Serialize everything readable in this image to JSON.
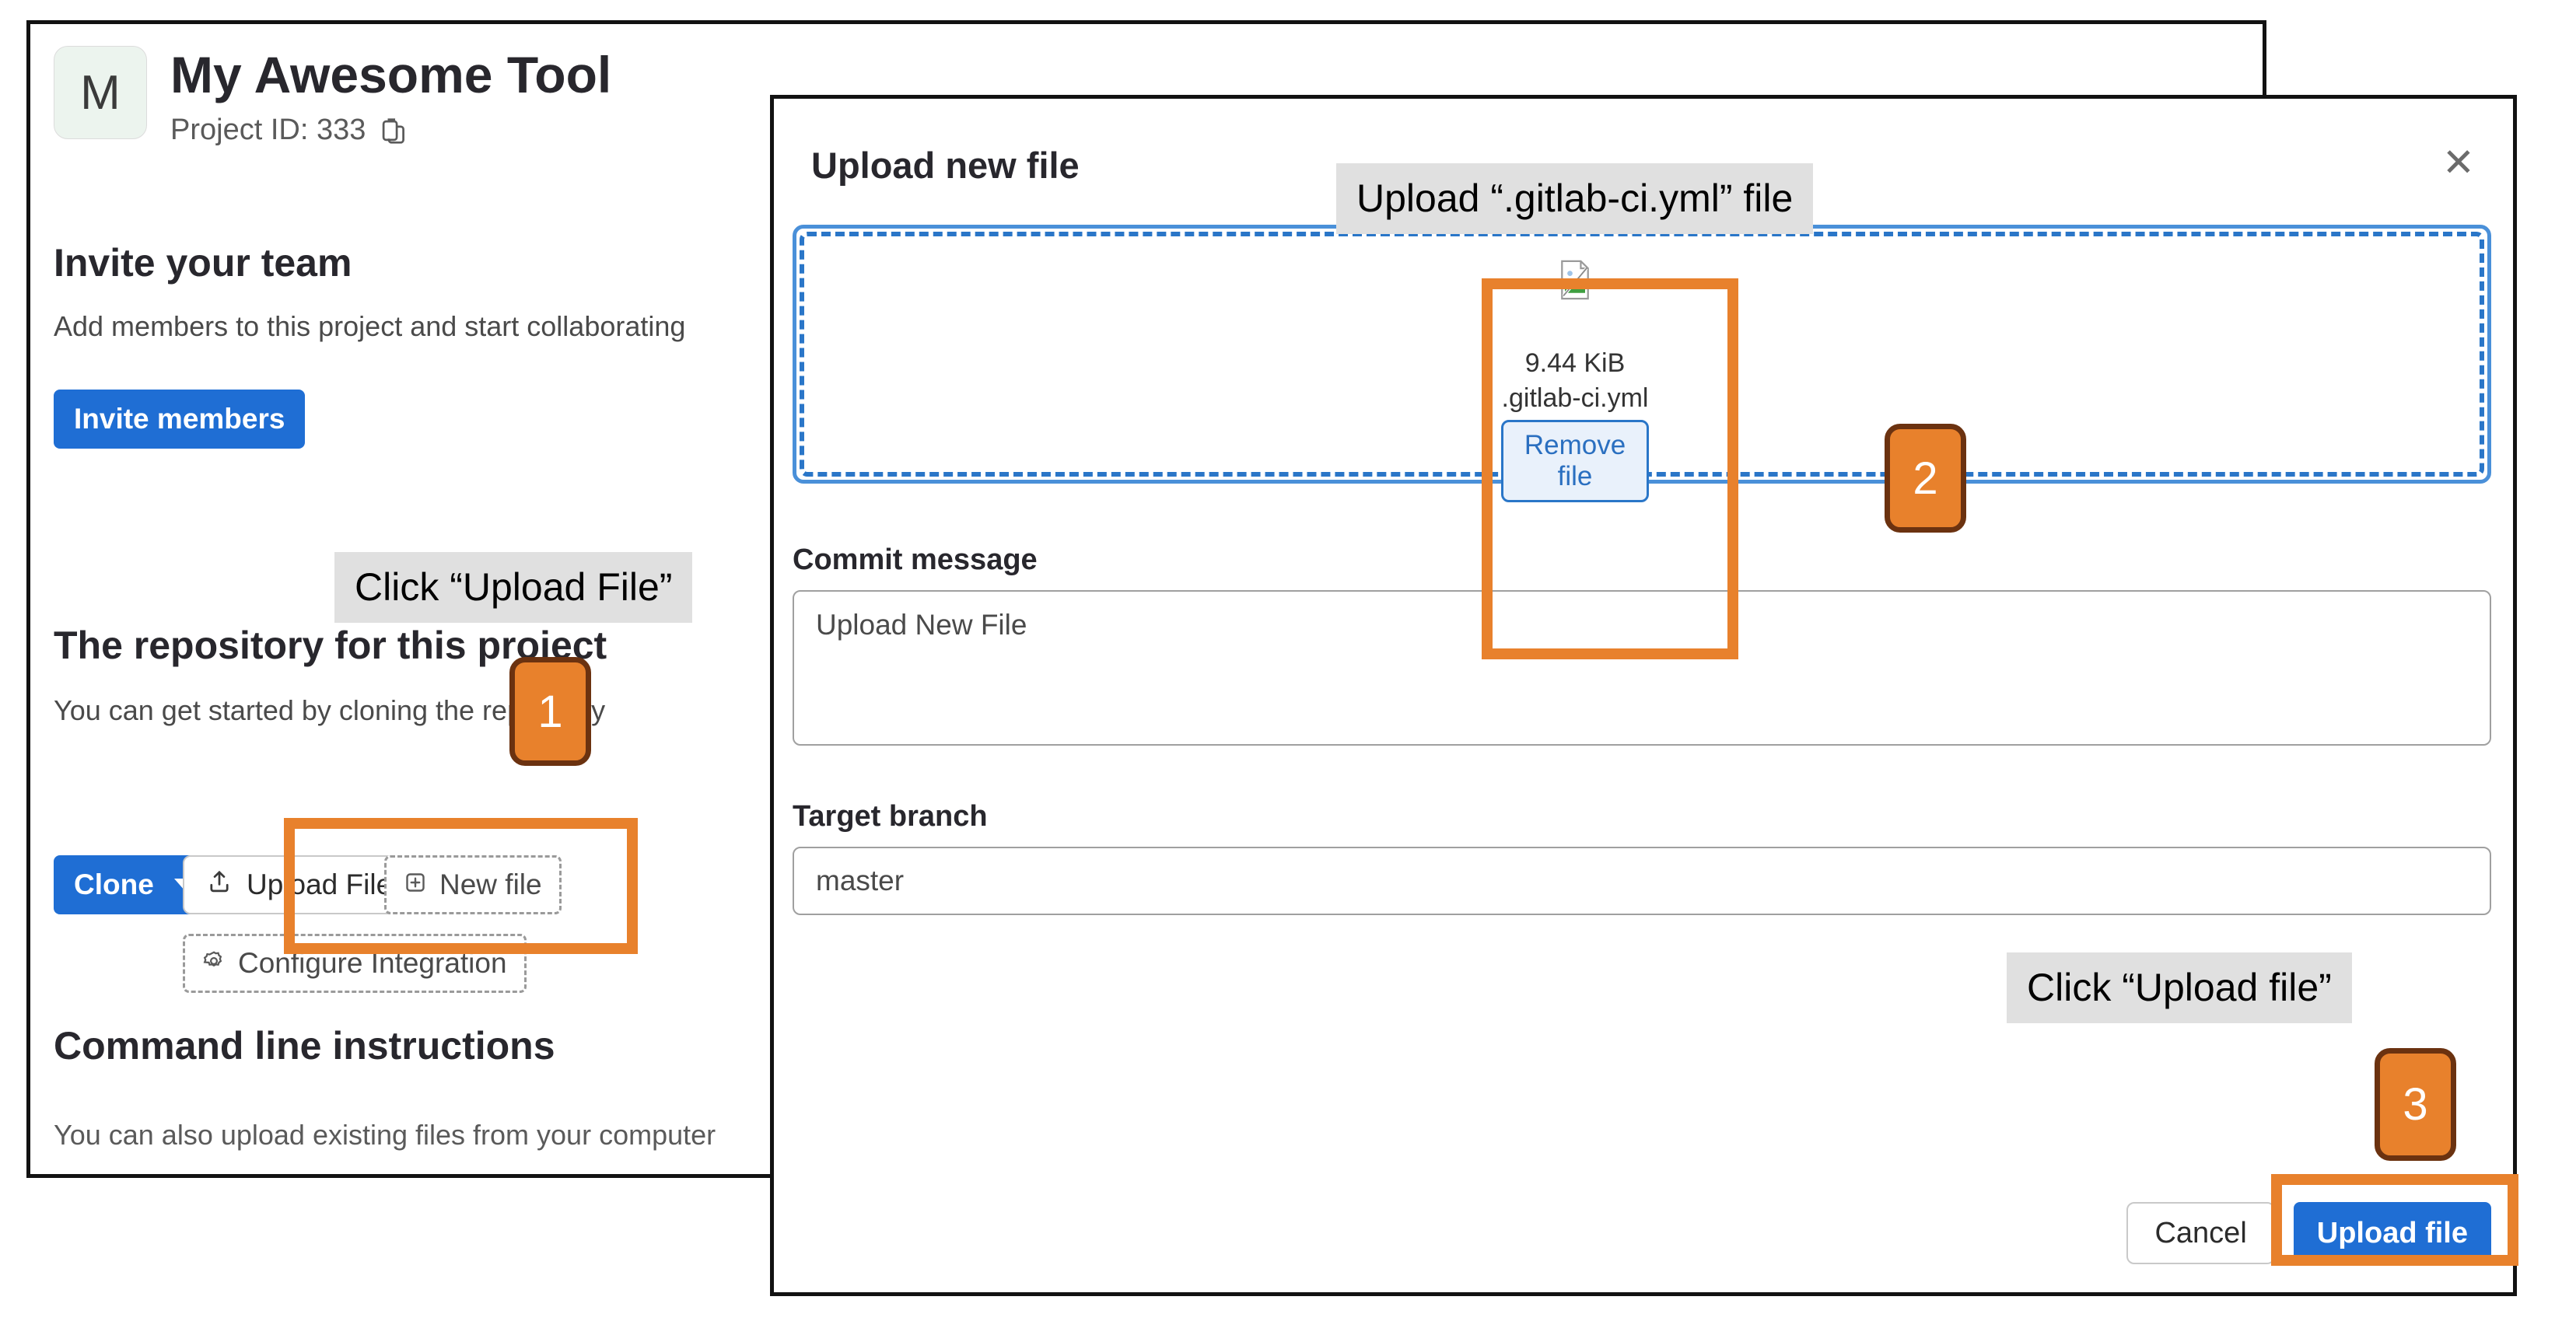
{
  "project": {
    "avatar_letter": "M",
    "title": "My Awesome Tool",
    "project_id_label": "Project ID: 333",
    "copy_icon": "copy-to-clipboard-icon"
  },
  "invite_section": {
    "heading": "Invite your team",
    "subtext": "Add members to this project and start collaborating",
    "button_label": "Invite members"
  },
  "repo_section": {
    "heading": "The repository for this project",
    "subtext": "You can get started by cloning the repository",
    "clone_label": "Clone",
    "upload_file_label": "Upload File",
    "upload_icon": "upload-arrow-icon",
    "new_file_label": "New file",
    "new_file_icon": "plus-square-icon",
    "configure_integration_label": "Configure Integration",
    "configure_icon": "gear-icon"
  },
  "cli_section": {
    "heading": "Command line instructions",
    "subtext": "You can also upload existing files from your computer"
  },
  "modal": {
    "title": "Upload new file",
    "close_icon": "close-x-icon",
    "dropzone": {
      "file_icon": "broken-image-icon",
      "file_size": "9.44 KiB",
      "file_name": ".gitlab-ci.yml",
      "remove_label": "Remove file"
    },
    "commit": {
      "label": "Commit message",
      "value": "Upload New File"
    },
    "branch": {
      "label": "Target branch",
      "value": "master"
    },
    "footer": {
      "cancel_label": "Cancel",
      "upload_label": "Upload file"
    }
  },
  "annotations": {
    "step1": {
      "number": "1",
      "text": "Click “Upload File”"
    },
    "step2": {
      "number": "2",
      "text": "Upload “.gitlab-ci.yml” file"
    },
    "step3": {
      "number": "3",
      "text": "Click “Upload file”"
    }
  },
  "colors": {
    "accent_blue": "#1f6ed4",
    "annotation_orange": "#e8812c",
    "annotation_orange_dark": "#6b3210",
    "dropzone_blue": "#2a76c8",
    "callout_bg": "#e0e0e0"
  }
}
